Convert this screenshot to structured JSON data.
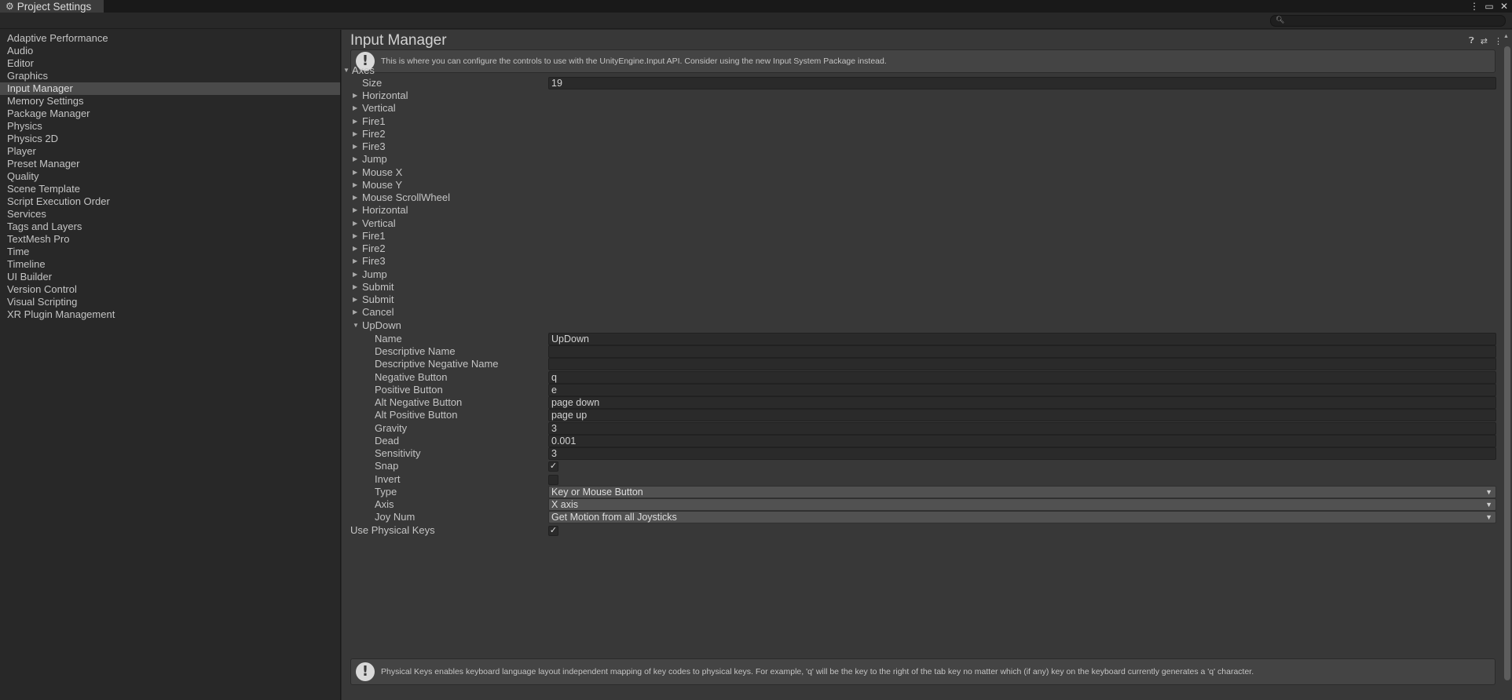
{
  "window": {
    "tab_title": "Project Settings",
    "controls": [
      "⋮",
      "▭",
      "✕"
    ]
  },
  "search": {
    "placeholder": "",
    "icon": "search-icon"
  },
  "sidebar": {
    "items": [
      {
        "label": "Adaptive Performance"
      },
      {
        "label": "Audio"
      },
      {
        "label": "Editor"
      },
      {
        "label": "Graphics"
      },
      {
        "label": "Input Manager",
        "selected": true
      },
      {
        "label": "Memory Settings"
      },
      {
        "label": "Package Manager"
      },
      {
        "label": "Physics"
      },
      {
        "label": "Physics 2D"
      },
      {
        "label": "Player"
      },
      {
        "label": "Preset Manager"
      },
      {
        "label": "Quality"
      },
      {
        "label": "Scene Template"
      },
      {
        "label": "Script Execution Order"
      },
      {
        "label": "Services"
      },
      {
        "label": "Tags and Layers"
      },
      {
        "label": "TextMesh Pro"
      },
      {
        "label": "Time"
      },
      {
        "label": "Timeline"
      },
      {
        "label": "UI Builder"
      },
      {
        "label": "Version Control"
      },
      {
        "label": "Visual Scripting"
      },
      {
        "label": "XR Plugin Management"
      }
    ]
  },
  "main": {
    "title": "Input Manager",
    "header_icons": [
      "help-icon",
      "preset-icon",
      "more-icon"
    ],
    "info_top": "This is where you can configure the controls to use with the UnityEngine.Input API. Consider using the new Input System Package instead.",
    "axes_label": "Axes",
    "size_label": "Size",
    "size_value": "19",
    "axes": [
      "Horizontal",
      "Vertical",
      "Fire1",
      "Fire2",
      "Fire3",
      "Jump",
      "Mouse X",
      "Mouse Y",
      "Mouse ScrollWheel",
      "Horizontal",
      "Vertical",
      "Fire1",
      "Fire2",
      "Fire3",
      "Jump",
      "Submit",
      "Submit",
      "Cancel"
    ],
    "expanded_axis": "UpDown",
    "props": {
      "name": {
        "label": "Name",
        "value": "UpDown"
      },
      "descriptive_name": {
        "label": "Descriptive Name",
        "value": ""
      },
      "descriptive_negative_name": {
        "label": "Descriptive Negative Name",
        "value": ""
      },
      "negative_button": {
        "label": "Negative Button",
        "value": "q"
      },
      "positive_button": {
        "label": "Positive Button",
        "value": "e"
      },
      "alt_negative_button": {
        "label": "Alt Negative Button",
        "value": "page down"
      },
      "alt_positive_button": {
        "label": "Alt Positive Button",
        "value": "page up"
      },
      "gravity": {
        "label": "Gravity",
        "value": "3"
      },
      "dead": {
        "label": "Dead",
        "value": "0.001"
      },
      "sensitivity": {
        "label": "Sensitivity",
        "value": "3"
      },
      "snap": {
        "label": "Snap",
        "checked": true
      },
      "invert": {
        "label": "Invert",
        "checked": false
      },
      "type": {
        "label": "Type",
        "value": "Key or Mouse Button"
      },
      "axis": {
        "label": "Axis",
        "value": "X axis"
      },
      "joy_num": {
        "label": "Joy Num",
        "value": "Get Motion from all Joysticks"
      }
    },
    "use_physical_keys": {
      "label": "Use Physical Keys",
      "checked": true
    },
    "info_bottom": "Physical Keys enables keyboard language layout independent mapping of key codes to physical keys. For example, 'q' will be the key to the right of the tab key no matter which (if any) key on the keyboard currently generates a 'q' character."
  }
}
